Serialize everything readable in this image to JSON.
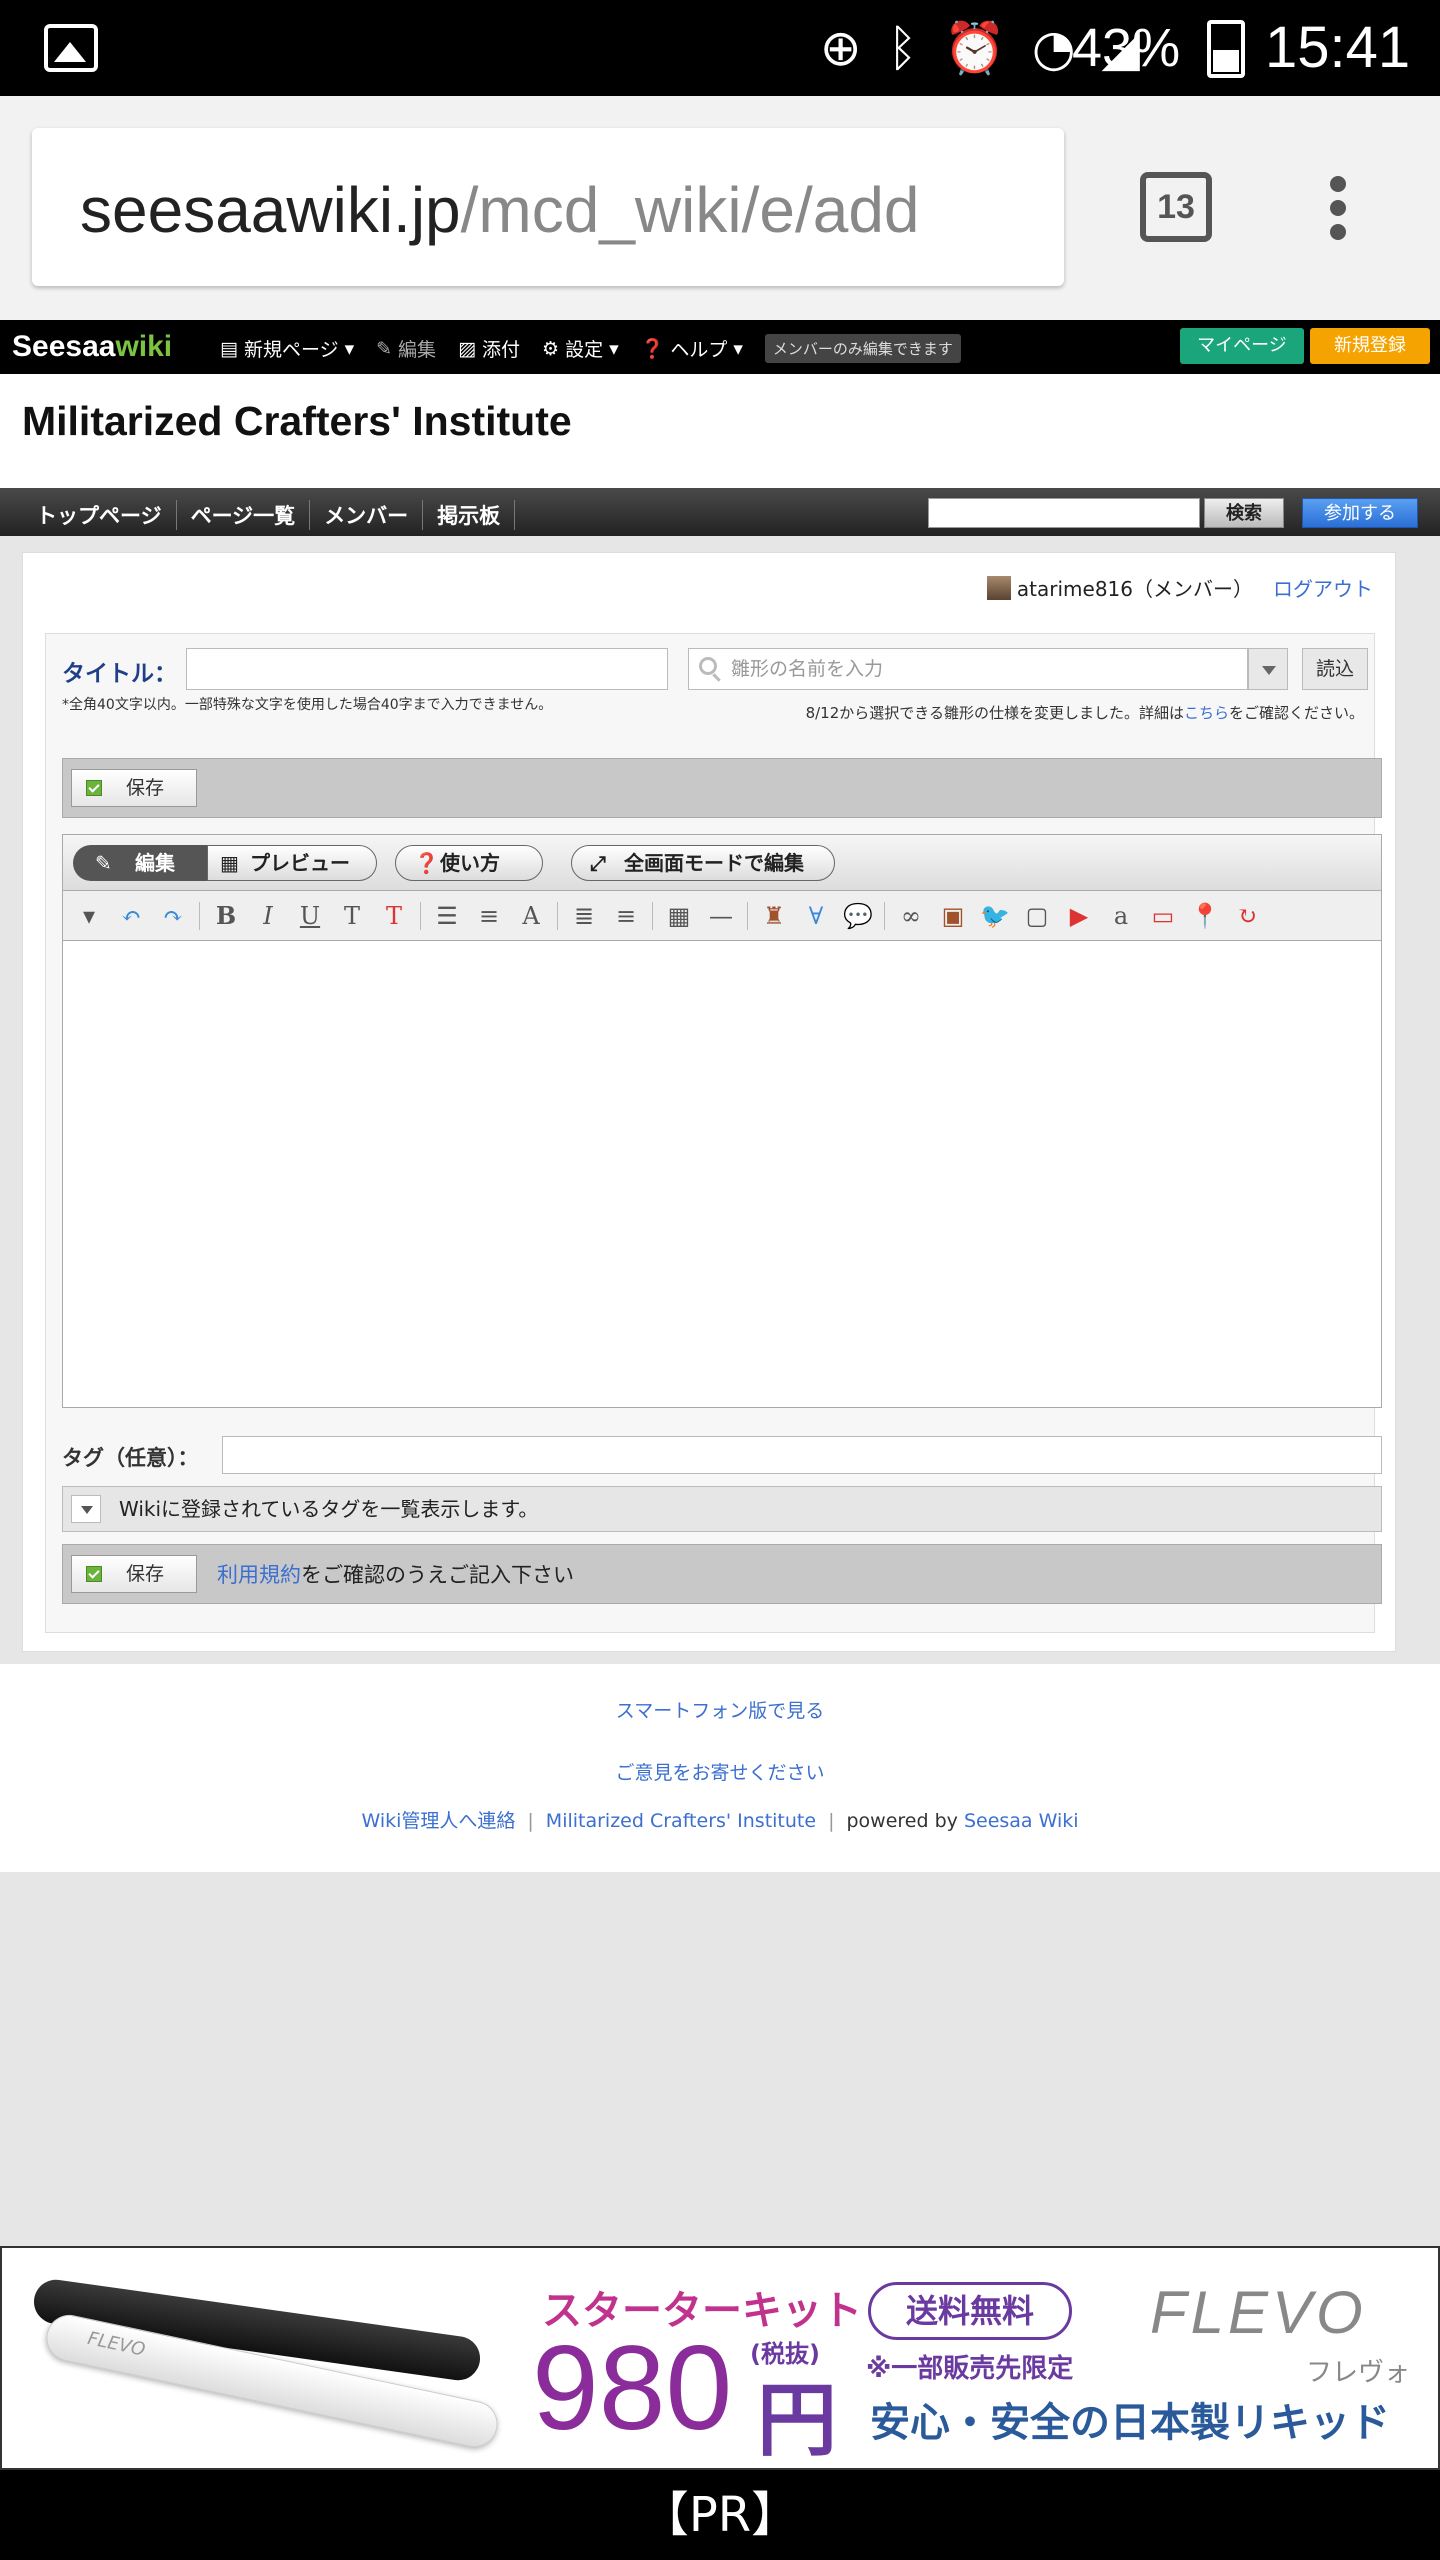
{
  "status_bar": {
    "battery": "43%",
    "time": "15:41"
  },
  "browser": {
    "url_host": "seesaawiki.jp",
    "url_path": "/mcd_wiki/e/add",
    "tab_count": "13"
  },
  "topbar": {
    "logo_left": "Seesaa",
    "logo_right": "wiki",
    "new_page": "新規ページ",
    "edit": "編集",
    "attach": "添付",
    "settings": "設定",
    "help": "ヘルプ",
    "members_only": "メンバーのみ編集できます",
    "mypage": "マイページ",
    "signup": "新規登録"
  },
  "site": {
    "title": "Militarized Crafters' Institute"
  },
  "gnav": {
    "links": [
      "トップページ",
      "ページ一覧",
      "メンバー",
      "掲示板"
    ],
    "search_button": "検索",
    "join_button": "参加する"
  },
  "user": {
    "name": "atarime816（メンバー）",
    "logout": "ログアウト"
  },
  "form": {
    "title_label": "タイトル：",
    "title_note": "*全角40文字以内。一部特殊な文字を使用した場合40字まで入力できません。",
    "template_placeholder": "雛形の名前を入力",
    "load_button": "読込",
    "template_note_prefix": "8/12から選択できる雛形の仕様を変更しました。詳細は",
    "template_note_link": "こちら",
    "template_note_suffix": "をご確認ください。",
    "save": "保存",
    "tab_edit": "編集",
    "tab_preview": "プレビュー",
    "usage": "使い方",
    "fullscreen": "全画面モードで編集",
    "tag_label": "タグ（任意）：",
    "tag_toggle": "Wikiに登録されているタグを一覧表示します。",
    "terms_link": "利用規約",
    "terms_suffix": "をご確認のうえご記入下さい"
  },
  "footer": {
    "smartphone": "スマートフォン版で見る",
    "feedback": "ご意見をお寄せください",
    "contact": "Wiki管理人へ連絡",
    "site_name": "Militarized Crafters' Institute",
    "powered_by": "powered by",
    "seesaa_wiki": "Seesaa Wiki"
  },
  "ad": {
    "starter": "スターターキット",
    "price": "980",
    "yen": "円",
    "tax": "(税抜)",
    "free_shipping": "送料無料",
    "limited": "※一部販売先限定",
    "safety": "安心・安全の日本製リキッド",
    "brand": "FLEVO",
    "brand_jp": "フレヴォ",
    "pen_label": "FLEVO"
  },
  "pr": "【PR】"
}
